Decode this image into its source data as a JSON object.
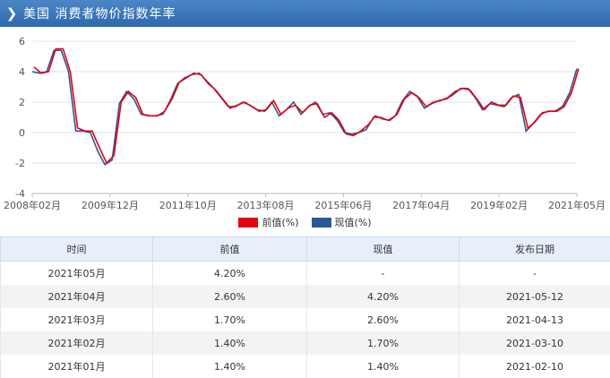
{
  "header": {
    "title": "美国  消费者物价指数年率",
    "chevron_icon": "chevron-right-icon"
  },
  "legend": {
    "prev_label": "前值(%)",
    "curr_label": "现值(%)",
    "prev_color": "#e60012",
    "curr_color": "#2b5797"
  },
  "chart_data": {
    "type": "line",
    "ylim": [
      -4,
      6
    ],
    "yticks": [
      -4,
      -2,
      0,
      2,
      4,
      6
    ],
    "x_tick_labels": [
      "2008年02月",
      "2009年12月",
      "2011年10月",
      "2013年08月",
      "2015年06月",
      "2017年04月",
      "2019年02月",
      "2021年05月"
    ],
    "series": [
      {
        "name": "现值(%)",
        "color": "#2b5797",
        "values": [
          4.0,
          3.9,
          4.0,
          5.4,
          5.4,
          4.0,
          0.1,
          0.1,
          0.0,
          -1.2,
          -2.1,
          -1.8,
          1.9,
          2.7,
          2.2,
          1.2,
          1.1,
          1.1,
          1.2,
          2.1,
          3.2,
          3.6,
          3.8,
          3.9,
          3.4,
          2.9,
          2.3,
          1.7,
          1.7,
          2.0,
          1.8,
          1.5,
          1.4,
          2.0,
          1.1,
          1.5,
          2.0,
          1.2,
          1.7,
          2.0,
          1.2,
          1.3,
          0.8,
          0.0,
          -0.1,
          0.0,
          0.2,
          1.0,
          1.0,
          0.8,
          1.1,
          2.1,
          2.7,
          2.4,
          1.6,
          1.9,
          2.1,
          2.2,
          2.5,
          2.9,
          2.9,
          2.3,
          1.5,
          1.9,
          1.8,
          1.7,
          2.3,
          2.5,
          0.1,
          0.6,
          1.2,
          1.4,
          1.4,
          1.7,
          2.6,
          4.2
        ]
      },
      {
        "name": "前值(%)",
        "color": "#e60012",
        "values": [
          4.3,
          3.9,
          4.0,
          5.5,
          5.5,
          4.0,
          0.3,
          0.1,
          0.1,
          -1.0,
          -2.0,
          -1.5,
          2.0,
          2.7,
          2.3,
          1.2,
          1.1,
          1.1,
          1.4,
          2.2,
          3.3,
          3.6,
          3.9,
          3.8,
          3.2,
          2.8,
          2.2,
          1.6,
          1.8,
          2.0,
          1.7,
          1.4,
          1.5,
          2.1,
          1.2,
          1.6,
          1.8,
          1.3,
          1.8,
          1.9,
          1.0,
          1.3,
          0.8,
          -0.1,
          -0.2,
          0.1,
          0.5,
          1.1,
          0.9,
          0.8,
          1.2,
          2.2,
          2.6,
          2.3,
          1.7,
          2.0,
          2.1,
          2.3,
          2.7,
          2.9,
          2.8,
          2.2,
          1.5,
          2.0,
          1.8,
          1.8,
          2.4,
          2.3,
          0.3,
          0.7,
          1.3,
          1.4,
          1.4,
          1.7,
          2.6,
          4.2
        ]
      }
    ]
  },
  "table": {
    "headers": [
      "时间",
      "前值",
      "现值",
      "发布日期"
    ],
    "rows": [
      [
        "2021年05月",
        "4.20%",
        "-",
        "-"
      ],
      [
        "2021年04月",
        "2.60%",
        "4.20%",
        "2021-05-12"
      ],
      [
        "2021年03月",
        "1.70%",
        "2.60%",
        "2021-04-13"
      ],
      [
        "2021年02月",
        "1.40%",
        "1.70%",
        "2021-03-10"
      ],
      [
        "2021年01月",
        "1.40%",
        "1.40%",
        "2021-02-10"
      ]
    ]
  }
}
